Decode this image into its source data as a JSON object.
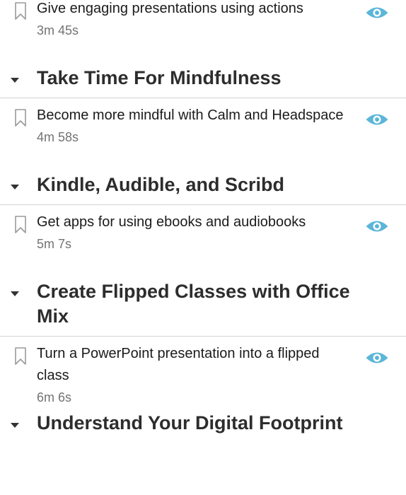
{
  "icons": {
    "bookmark": "bookmark-icon",
    "viewed": "eye-icon",
    "collapse": "caret-down-icon"
  },
  "colors": {
    "eye": "#5bb6d8",
    "bookmark": "#9a9a9a",
    "chapter_text": "#2d2d2d",
    "duration_text": "#737373",
    "divider": "#d4d4d4"
  },
  "toc": {
    "items": [
      {
        "type": "video",
        "title": "Give engaging presentations using actions",
        "duration": "3m 45s"
      },
      {
        "type": "chapter",
        "title": "Take Time For Mindfulness"
      },
      {
        "type": "video",
        "title": "Become more mindful with Calm and Headspace",
        "duration": "4m 58s"
      },
      {
        "type": "chapter",
        "title": "Kindle, Audible, and Scribd"
      },
      {
        "type": "video",
        "title": "Get apps for using ebooks and audiobooks",
        "duration": "5m 7s"
      },
      {
        "type": "chapter",
        "title": "Create Flipped Classes with Office Mix"
      },
      {
        "type": "video",
        "title": "Turn a PowerPoint presentation into a flipped class",
        "duration": "6m 6s"
      },
      {
        "type": "chapter",
        "title": "Understand Your Digital Footprint"
      }
    ]
  }
}
